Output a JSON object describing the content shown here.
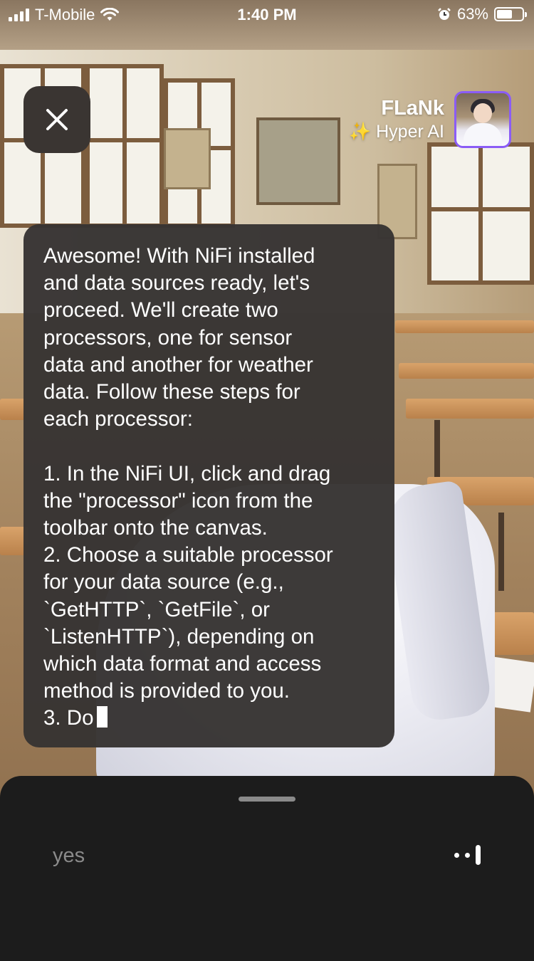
{
  "status_bar": {
    "carrier": "T-Mobile",
    "time": "1:40 PM",
    "battery_percent": "63%",
    "battery_level": 0.63,
    "icons": [
      "signal-icon",
      "wifi-icon",
      "alarm-icon",
      "battery-icon"
    ]
  },
  "header": {
    "close_icon": "close-icon",
    "character_name": "FLaNk",
    "character_subtitle": "✨ Hyper AI"
  },
  "chat": {
    "message": "Awesome! With NiFi installed\nand data sources ready, let's\nproceed. We'll create two\nprocessors, one for sensor\ndata and another for weather\ndata. Follow these steps for\neach processor:\n\n1. In the NiFi UI, click and drag\nthe \"processor\" icon from the\ntoolbar onto the canvas.\n2. Choose a suitable processor\nfor your data source (e.g.,\n`GetHTTP`, `GetFile`, or\n`ListenHTTP`), depending on\nwhich data format and access\nmethod is provided to you.\n3. Do"
  },
  "composer": {
    "input_text": "yes",
    "voice_icon": "voice-input-icon"
  },
  "colors": {
    "bubble_bg": "#373433",
    "sheet_bg": "#1c1c1c",
    "avatar_border": "#8b5cf6",
    "placeholder_text": "#8a8a8a"
  }
}
